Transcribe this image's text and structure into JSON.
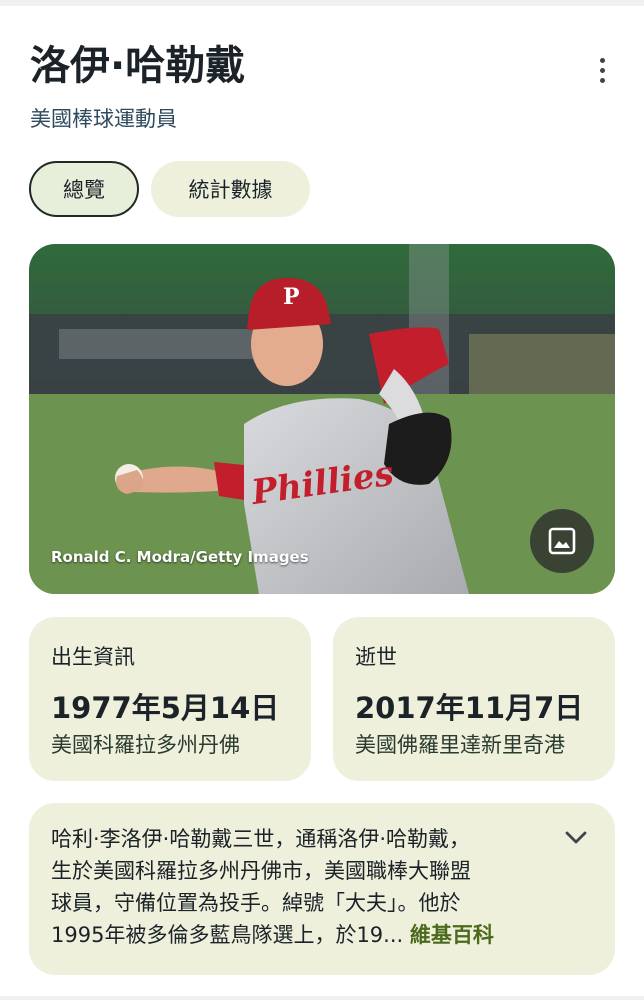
{
  "header": {
    "title": "洛伊·哈勒戴",
    "subtitle": "美國棒球運動員",
    "more_icon": "more-vert-icon"
  },
  "tabs": [
    {
      "label": "總覽",
      "selected": true
    },
    {
      "label": "統計數據",
      "selected": false
    }
  ],
  "photo": {
    "credit": "Ronald C. Modra/Getty Images",
    "jersey_text": "Phillies",
    "cap_letter": "P",
    "image_button_icon": "image-icon"
  },
  "born": {
    "label": "出生資訊",
    "date": "1977年5月14日",
    "place": "美國科羅拉多州丹佛"
  },
  "died": {
    "label": "逝世",
    "date": "2017年11月7日",
    "place": "美國佛羅里達新里奇港"
  },
  "summary": {
    "lines": [
      "哈利·李洛伊·哈勒戴三世，通稱洛伊·哈勒戴，",
      "生於美國科羅拉多州丹佛市，美國職棒大聯盟",
      "球員，守備位置為投手。綽號「大夫」。他於",
      "1995年被多倫多藍鳥隊選上，於19..."
    ],
    "source_link": "維基百科",
    "expand_icon": "chevron-down-icon"
  },
  "colors": {
    "card_bg": "#eef0dc",
    "link": "#4b6a1c",
    "text": "#1b2329",
    "image_button": "#3a4234"
  }
}
